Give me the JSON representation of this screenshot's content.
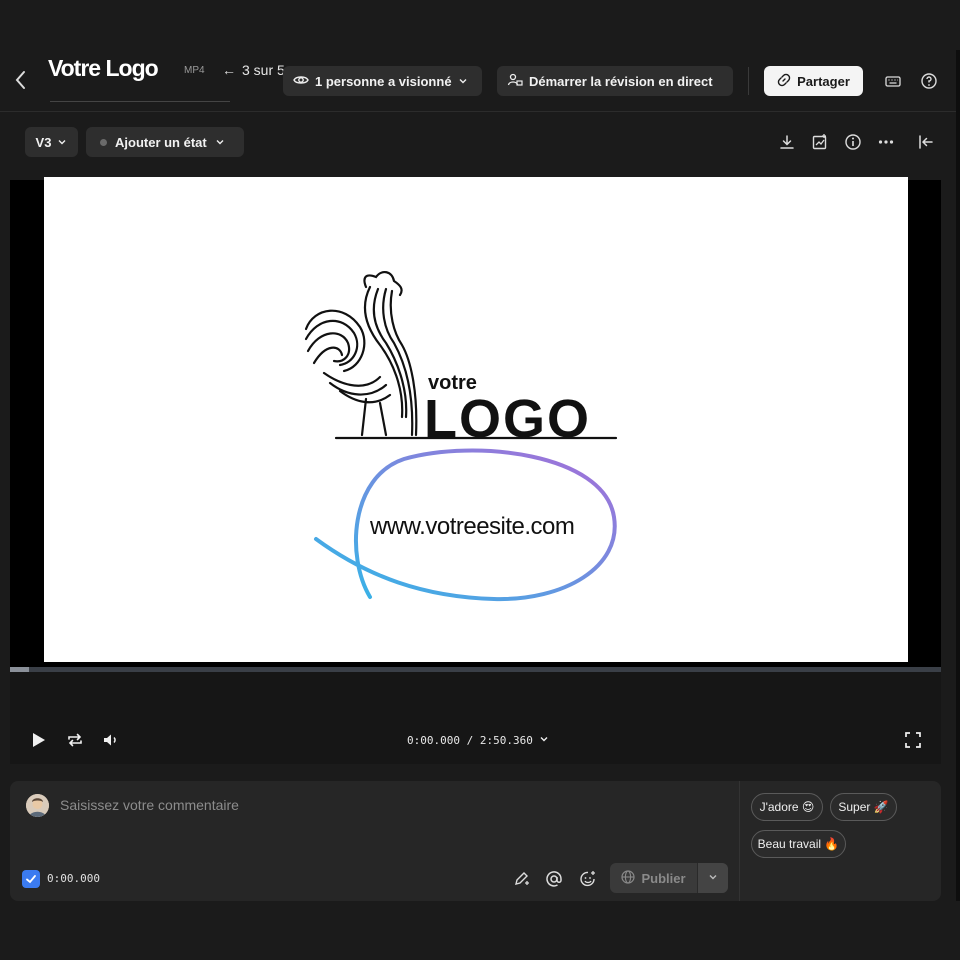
{
  "header": {
    "title": "Votre Logo",
    "format": "MP4",
    "pager": "3 sur 5",
    "viewers_label": "1 personne a visionné",
    "review_label": "Démarrer la révision en direct",
    "share_label": "Partager"
  },
  "toolbar": {
    "version": "V3",
    "status_label": "Ajouter un état"
  },
  "video": {
    "brand_small": "votre",
    "brand_big": "LOGO",
    "website": "www.votreesite.com",
    "progress": 0.02
  },
  "controls": {
    "time": "0:00.000 / 2:50.360"
  },
  "comment": {
    "placeholder": "Saisissez votre commentaire",
    "timestamp": "0:00.000",
    "publish_label": "Publier",
    "reactions": [
      "J'adore 😍",
      "Super 🚀",
      "Beau travail 🔥"
    ]
  },
  "colors": {
    "accent": "#3b7bf0",
    "circle_start": "#2fb8e8",
    "circle_end": "#a96cd8"
  }
}
